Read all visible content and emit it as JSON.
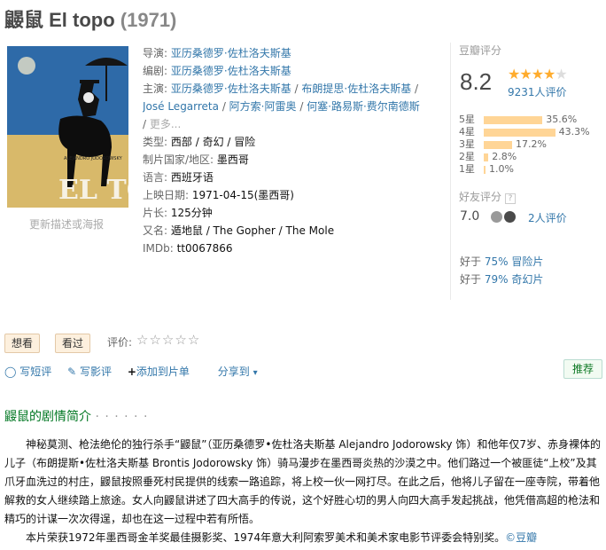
{
  "title": {
    "main": "鼹鼠 El topo",
    "year": "(1971)"
  },
  "poster": {
    "caption": "更新描述或海报",
    "poster_title": "EL TOPO",
    "poster_credit": "ALEJANDRO JODOROWSKY"
  },
  "info": {
    "director_label": "导演:",
    "director": "亚历桑德罗·佐杜洛夫斯基",
    "writer_label": "编剧:",
    "writer": "亚历桑德罗·佐杜洛夫斯基",
    "cast_label": "主演:",
    "cast": [
      "亚历桑德罗·佐杜洛夫斯基",
      "布朗提思·佐杜洛夫斯基",
      "José Legarreta",
      "阿方索·阿雷奥",
      "何塞·路易斯·费尔南德斯"
    ],
    "cast_more": "更多...",
    "genre_label": "类型:",
    "genres": [
      "西部",
      "奇幻",
      "冒险"
    ],
    "country_label": "制片国家/地区:",
    "country": "墨西哥",
    "language_label": "语言:",
    "language": "西班牙语",
    "release_label": "上映日期:",
    "release": "1971-04-15(墨西哥)",
    "runtime_label": "片长:",
    "runtime": "125分钟",
    "aka_label": "又名:",
    "aka": "遁地鼠 / The Gopher / The Mole",
    "imdb_label": "IMDb:",
    "imdb": "tt0067866"
  },
  "rating": {
    "header": "豆瓣评分",
    "score": "8.2",
    "stars": 4,
    "people": "9231人评价",
    "breakdown": [
      {
        "label": "5星",
        "pct": "35.6%",
        "value": 35.6
      },
      {
        "label": "4星",
        "pct": "43.3%",
        "value": 43.3
      },
      {
        "label": "3星",
        "pct": "17.2%",
        "value": 17.2
      },
      {
        "label": "2星",
        "pct": "2.8%",
        "value": 2.8
      },
      {
        "label": "1星",
        "pct": "1.0%",
        "value": 1.0
      }
    ],
    "friend_header": "好友评分",
    "friend_help": "?",
    "friend_score": "7.0",
    "friend_count": "2人评价",
    "better1_prefix": "好于",
    "better1_pct": "75%",
    "better1_genre": "冒险片",
    "better2_prefix": "好于",
    "better2_pct": "79%",
    "better2_genre": "奇幻片"
  },
  "actions": {
    "want": "想看",
    "seen": "看过",
    "my_rating_label": "评价:",
    "write_short": "写短评",
    "write_review": "写影评",
    "add_list": "添加到片单",
    "share": "分享到",
    "recommend": "推荐"
  },
  "synopsis": {
    "title": "鼹鼠的剧情简介",
    "dots": "· · · · · ·",
    "para1": "神秘莫测、枪法绝伦的独行杀手“鼹鼠”（亚历桑德罗•佐杜洛夫斯基 Alejandro Jodorowsky 饰）和他年仅7岁、赤身裸体的儿子（布朗提斯•佐杜洛夫斯基 Brontis Jodorowsky 饰）骑马漫步在墨西哥炎热的沙漠之中。他们路过一个被匪徒“上校”及其爪牙血洗过的村庄，鼹鼠按照垂死村民提供的线索一路追踪，将上校一伙一网打尽。在此之后，他将儿子留在一座寺院，带着他解救的女人继续踏上旅途。女人向鼹鼠讲述了四大高手的传说，这个好胜心切的男人向四大高手发起挑战，他凭借高超的枪法和精巧的计谋一次次得逞，却也在这一过程中若有所悟。",
    "para2": "本片荣获1972年墨西哥金羊奖最佳摄影奖、1974年意大利阿索罗美术和美术家电影节评委会特别奖。",
    "credit": "©豆瓣"
  },
  "colors": {
    "link": "#3377aa",
    "star": "#ffac2d",
    "bar": "#ffd596",
    "green": "#007722"
  }
}
